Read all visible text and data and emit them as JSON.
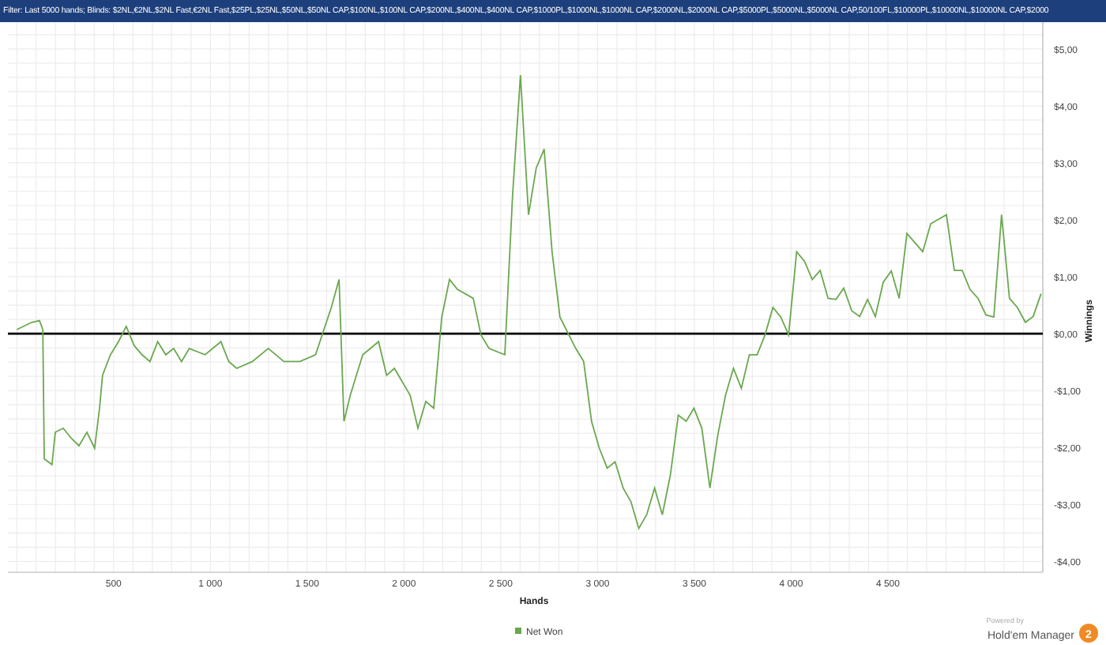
{
  "filter_bar": {
    "text": "Filter: Last 5000 hands; Blinds: $2NL,€2NL,$2NL Fast,€2NL Fast,$25PL,$25NL,$50NL,$50NL CAP,$100NL,$100NL CAP,$200NL,$400NL,$400NL CAP,$1000PL,$1000NL,$1000NL CAP,$2000NL,$2000NL CAP,$5000PL,$5000NL,$5000NL CAP,50/100FL,$10000PL,$10000NL,$10000NL CAP,$2000"
  },
  "chart": {
    "chart_data": {
      "type": "line",
      "xlabel": "Hands",
      "ylabel": "Winnings",
      "grid": true,
      "xlim": [
        -46,
        5300
      ],
      "ylim": [
        -4.19,
        5.47
      ],
      "xticks": [
        {
          "value": 500,
          "label": "500"
        },
        {
          "value": 1000,
          "label": "1 000"
        },
        {
          "value": 1500,
          "label": "1 500"
        },
        {
          "value": 2000,
          "label": "2 000"
        },
        {
          "value": 2500,
          "label": "2 500"
        },
        {
          "value": 3000,
          "label": "3 000"
        },
        {
          "value": 3500,
          "label": "3 500"
        },
        {
          "value": 4000,
          "label": "4 000"
        },
        {
          "value": 4500,
          "label": "4 500"
        }
      ],
      "yticks": [
        {
          "value": 5,
          "label": "$5,00"
        },
        {
          "value": 4,
          "label": "$4,00"
        },
        {
          "value": 3,
          "label": "$3,00"
        },
        {
          "value": 2,
          "label": "$2,00"
        },
        {
          "value": 1,
          "label": "$1,00"
        },
        {
          "value": 0,
          "label": "$0,00"
        },
        {
          "value": -1,
          "label": "-$1,00"
        },
        {
          "value": -2,
          "label": "-$2,00"
        },
        {
          "value": -3,
          "label": "-$3,00"
        },
        {
          "value": -4,
          "label": "-$4,00"
        }
      ],
      "x": [
        0,
        77,
        117,
        134,
        142,
        182,
        199,
        240,
        280,
        321,
        362,
        402,
        427,
        443,
        484,
        525,
        565,
        606,
        647,
        688,
        728,
        769,
        810,
        851,
        891,
        973,
        1054,
        1095,
        1136,
        1217,
        1299,
        1380,
        1462,
        1543,
        1625,
        1665,
        1690,
        1723,
        1787,
        1869,
        1910,
        1950,
        2032,
        2072,
        2113,
        2154,
        2195,
        2235,
        2276,
        2358,
        2398,
        2439,
        2521,
        2561,
        2602,
        2643,
        2683,
        2724,
        2765,
        2806,
        2887,
        2928,
        2969,
        3009,
        3050,
        3091,
        3132,
        3172,
        3213,
        3254,
        3295,
        3335,
        3376,
        3417,
        3458,
        3498,
        3539,
        3580,
        3621,
        3661,
        3702,
        3743,
        3784,
        3824,
        3865,
        3906,
        3947,
        3987,
        4028,
        4069,
        4109,
        4150,
        4191,
        4232,
        4272,
        4313,
        4354,
        4395,
        4435,
        4476,
        4517,
        4558,
        4598,
        4639,
        4680,
        4721,
        4802,
        4843,
        4884,
        4924,
        4965,
        5006,
        5047,
        5087,
        5128,
        5169,
        5210,
        5250,
        5291
      ],
      "series": [
        {
          "name": "Net Won",
          "color": "#6aa84f",
          "values": [
            0.07,
            0.2,
            0.23,
            0.07,
            -2.2,
            -2.3,
            -1.73,
            -1.66,
            -1.83,
            -1.97,
            -1.73,
            -2.01,
            -1.31,
            -0.73,
            -0.37,
            -0.14,
            0.13,
            -0.21,
            -0.37,
            -0.49,
            -0.14,
            -0.37,
            -0.26,
            -0.49,
            -0.26,
            -0.37,
            -0.14,
            -0.49,
            -0.61,
            -0.49,
            -0.26,
            -0.49,
            -0.49,
            -0.37,
            0.46,
            0.95,
            -1.54,
            -1.08,
            -0.37,
            -0.14,
            -0.73,
            -0.61,
            -1.08,
            -1.66,
            -1.19,
            -1.31,
            0.29,
            0.95,
            0.78,
            0.62,
            -0.02,
            -0.26,
            -0.37,
            2.42,
            4.54,
            2.09,
            2.91,
            3.24,
            1.44,
            0.29,
            -0.26,
            -0.49,
            -1.54,
            -2.01,
            -2.36,
            -2.25,
            -2.71,
            -2.95,
            -3.42,
            -3.18,
            -2.71,
            -3.18,
            -2.48,
            -1.43,
            -1.54,
            -1.31,
            -1.66,
            -2.71,
            -1.78,
            -1.08,
            -0.61,
            -0.96,
            -0.37,
            -0.37,
            -0.02,
            0.46,
            0.29,
            -0.02,
            1.44,
            1.27,
            0.95,
            1.11,
            0.62,
            0.6,
            0.8,
            0.4,
            0.3,
            0.6,
            0.3,
            0.9,
            1.1,
            0.62,
            1.76,
            1.6,
            1.44,
            1.93,
            2.09,
            1.11,
            1.11,
            0.78,
            0.62,
            0.33,
            0.29,
            2.09,
            0.62,
            0.46,
            0.2,
            0.3,
            0.7
          ]
        }
      ]
    }
  },
  "branding": {
    "caption": "Powered by",
    "product": "Hold'em Manager",
    "badge": "2"
  }
}
